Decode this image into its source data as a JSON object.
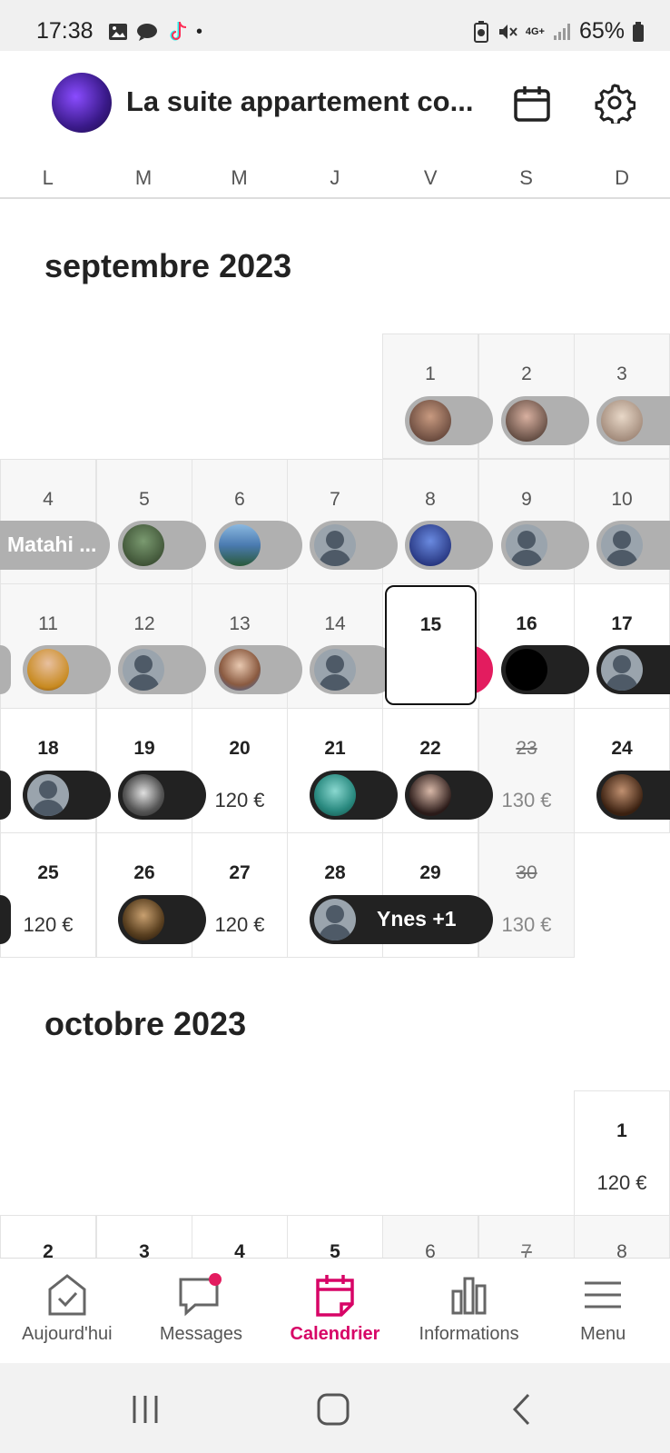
{
  "status": {
    "time": "17:38",
    "battery": "65%",
    "network": "4G+"
  },
  "header": {
    "title": "La suite appartement co..."
  },
  "weekdays": [
    "L",
    "M",
    "M",
    "J",
    "V",
    "S",
    "D"
  ],
  "months": [
    {
      "label": "septembre 2023"
    },
    {
      "label": "octobre 2023"
    }
  ],
  "colors": {
    "accent": "#e31c5f",
    "nav_active": "#d70466",
    "booked": "#222222",
    "past": "#b0b0b0"
  },
  "days": {
    "d1": "1",
    "d2": "2",
    "d3": "3",
    "d4": "4",
    "d5": "5",
    "d6": "6",
    "d7": "7",
    "d8": "8",
    "d9": "9",
    "d10": "10",
    "d11": "11",
    "d12": "12",
    "d13": "13",
    "d14": "14",
    "d15": "15",
    "d16": "16",
    "d17": "17",
    "d18": "18",
    "d19": "19",
    "d20": "20",
    "d21": "21",
    "d22": "22",
    "d23": "23",
    "d24": "24",
    "d25": "25",
    "d26": "26",
    "d27": "27",
    "d28": "28",
    "d29": "29",
    "d30": "30",
    "o1": "1",
    "o2": "2",
    "o3": "3",
    "o4": "4",
    "o5": "5",
    "o6": "6",
    "o7": "7",
    "o8": "8"
  },
  "prices": {
    "s20": "120 €",
    "s23": "130 €",
    "s25": "120 €",
    "s27": "120 €",
    "s30": "130 €",
    "o1": "120 €"
  },
  "guests": {
    "matahi": "Matahi ...",
    "ynes": "Ynes +1"
  },
  "nav": {
    "notification": "red-dot",
    "items": [
      {
        "label": "Aujourd'hui",
        "icon": "today-check-icon"
      },
      {
        "label": "Messages",
        "icon": "message-icon"
      },
      {
        "label": "Calendrier",
        "icon": "calendar-icon"
      },
      {
        "label": "Informations",
        "icon": "bar-chart-icon"
      },
      {
        "label": "Menu",
        "icon": "menu-icon"
      }
    ]
  }
}
